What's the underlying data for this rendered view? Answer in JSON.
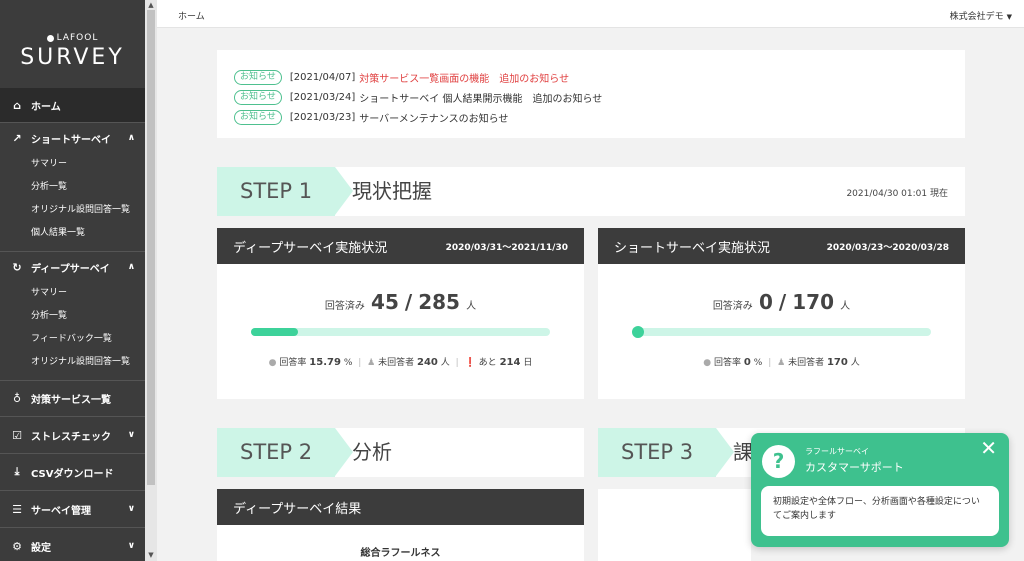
{
  "brand": {
    "sub": "LAFOOL",
    "main": "SURVEY"
  },
  "sidebar": {
    "home": "ホーム",
    "short": {
      "label": "ショートサーベイ",
      "items": [
        "サマリー",
        "分析一覧",
        "オリジナル設問回答一覧",
        "個人結果一覧"
      ]
    },
    "deep": {
      "label": "ディープサーベイ",
      "items": [
        "サマリー",
        "分析一覧",
        "フィードバック一覧",
        "オリジナル設問回答一覧"
      ]
    },
    "measures": "対策サービス一覧",
    "stress": "ストレスチェック",
    "csv": "CSVダウンロード",
    "manage": "サーベイ管理",
    "settings": "設定"
  },
  "header": {
    "breadcrumb": "ホーム",
    "company": "株式会社デモ"
  },
  "notices": [
    {
      "tag": "お知らせ",
      "date": "[2021/04/07]",
      "text": "対策サービス一覧画面の機能　追加のお知らせ"
    },
    {
      "tag": "お知らせ",
      "date": "[2021/03/24]",
      "text": "ショートサーベイ 個人結果開示機能　追加のお知らせ"
    },
    {
      "tag": "お知らせ",
      "date": "[2021/03/23]",
      "text": "サーバーメンテナンスのお知らせ"
    }
  ],
  "step1": {
    "label": "STEP 1",
    "title": "現状把握",
    "date": "2021/04/30 01:01 現在"
  },
  "deep_status": {
    "title": "ディープサーベイ実施状況",
    "period": "2020/03/31～2021/11/30",
    "answered_label": "回答済み",
    "answered": "45",
    "slash": "/",
    "total": "285",
    "unit": "人",
    "progress": 0.158,
    "rate_label": "回答率",
    "rate": "15.79",
    "rate_unit": "%",
    "unanswered_label": "未回答者",
    "unanswered": "240",
    "unanswered_unit": "人",
    "remain_label": "あと",
    "remain": "214",
    "remain_unit": "日"
  },
  "short_status": {
    "title": "ショートサーベイ実施状況",
    "period": "2020/03/23～2020/03/28",
    "answered_label": "回答済み",
    "answered": "0",
    "slash": "/",
    "total": "170",
    "unit": "人",
    "progress": 0,
    "rate_label": "回答率",
    "rate": "0",
    "rate_unit": "%",
    "unanswered_label": "未回答者",
    "unanswered": "170",
    "unanswered_unit": "人"
  },
  "step2": {
    "label": "STEP 2",
    "title": "分析"
  },
  "step3": {
    "label": "STEP 3",
    "title": "課"
  },
  "deep_result": {
    "title": "ディープサーベイ結果",
    "subtitle": "総合ラフールネス"
  },
  "support": {
    "small": "ラフールサーベイ",
    "title": "カスタマーサポート",
    "close": "✕",
    "message": "初期設定や全体フロー、分析画面や各種設定についてご案内します"
  },
  "colors": {
    "accent": "#3dd29a",
    "accent_light": "#cdf5e7",
    "sidebar": "#3c3c3c",
    "alert": "#e04040"
  }
}
